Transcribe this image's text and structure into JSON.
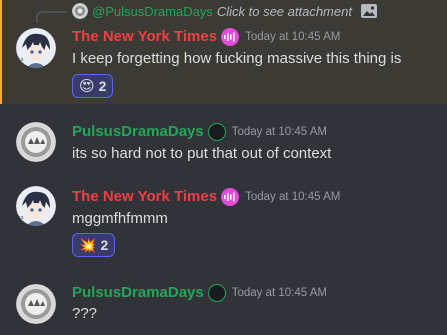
{
  "reply": {
    "author": "@PulsusDramaDays",
    "text": "Click to see attachment"
  },
  "messages": [
    {
      "author": "The New York Times",
      "author_color": "#f23f42",
      "timestamp": "Today at 10:45 AM",
      "content": "I keep forgetting how fucking massive this thing is",
      "reaction": {
        "emoji": "😍",
        "count": "2"
      }
    },
    {
      "author": "PulsusDramaDays",
      "author_color": "#23a55a",
      "timestamp": "Today at 10:45 AM",
      "content": "its so hard not to put that out of context"
    },
    {
      "author": "The New York Times",
      "author_color": "#f23f42",
      "timestamp": "Today at 10:45 AM",
      "content": "mggmfhfmmm",
      "reaction": {
        "emoji": "💥",
        "count": "2"
      }
    },
    {
      "author": "PulsusDramaDays",
      "author_color": "#23a55a",
      "timestamp": "Today at 10:45 AM",
      "content": "???"
    }
  ],
  "colors": {
    "background": "#323339",
    "mention_highlight": "#3b3a35",
    "mention_bar": "#f0b232",
    "nyt_badge": "#e24bd8",
    "reaction_bg": "#393c6b",
    "reaction_border": "#5865f2"
  },
  "icons": {
    "nyt_badge": "sound-wave-icon",
    "pulsus_badge": "green-ring-icon",
    "reply_attachment": "image-icon"
  }
}
